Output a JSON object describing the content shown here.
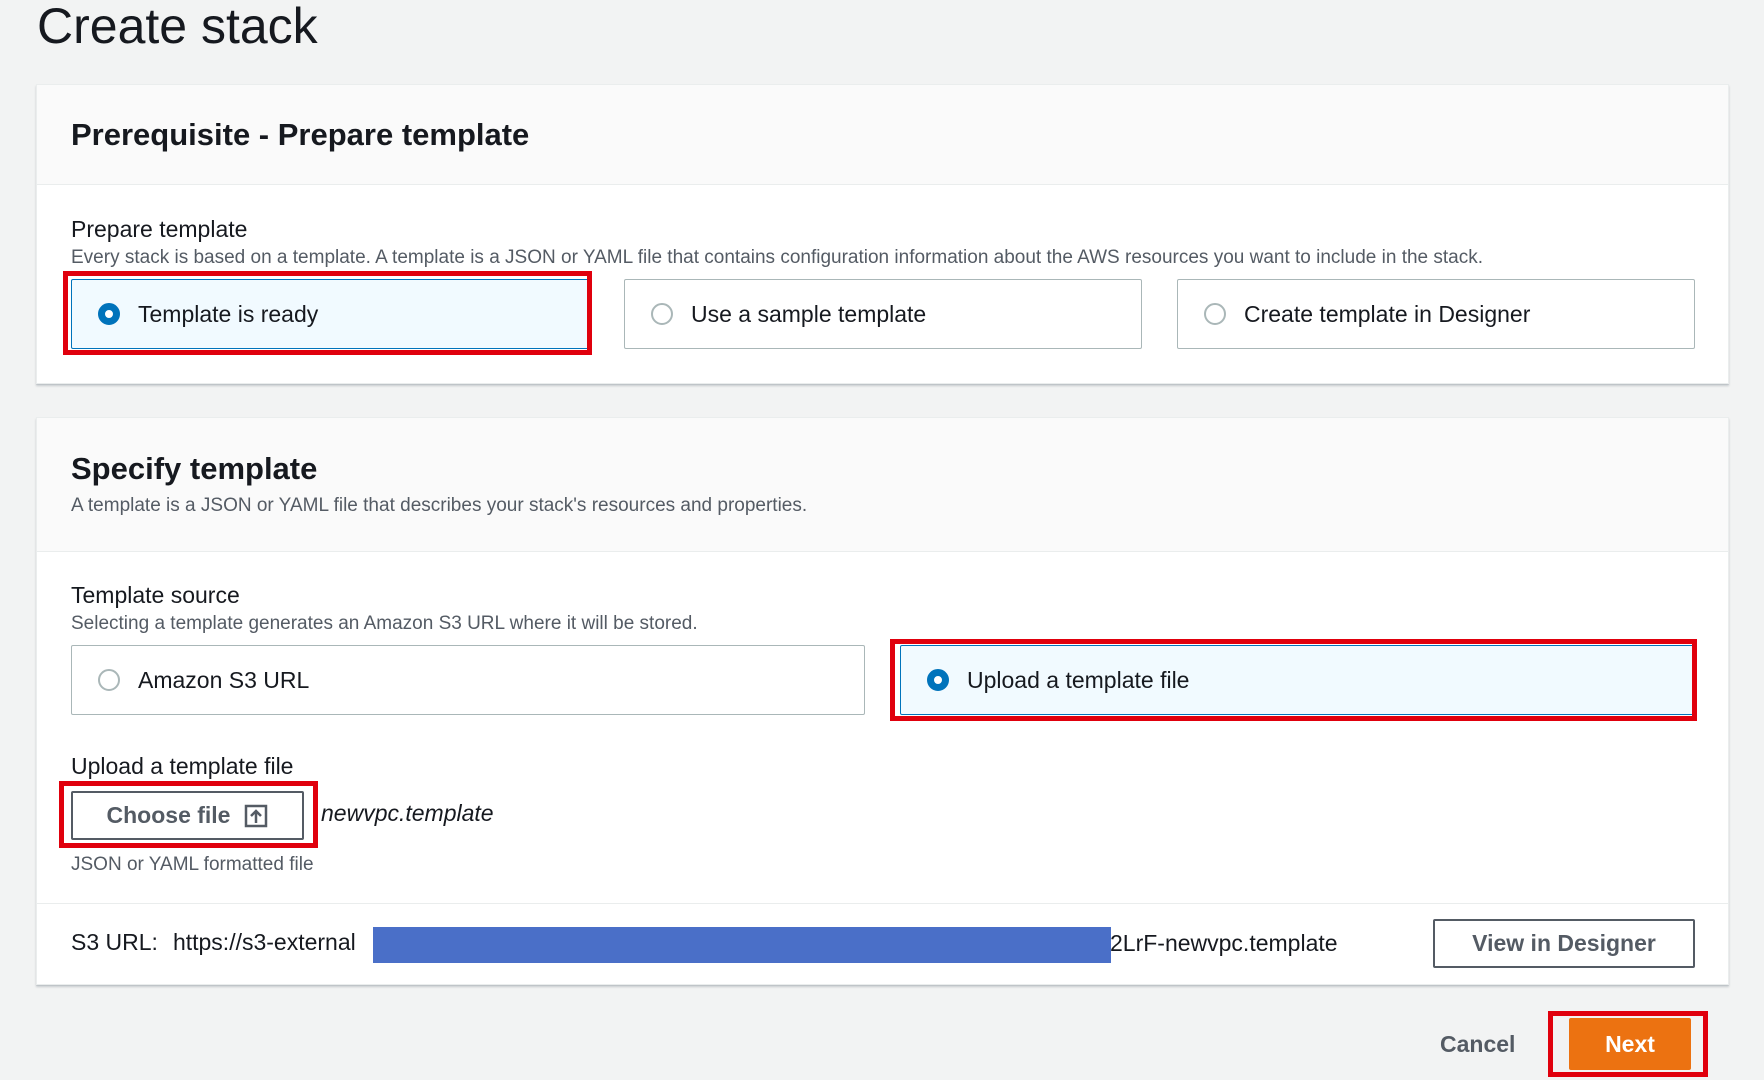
{
  "page": {
    "title": "Create stack"
  },
  "prerequisite": {
    "title": "Prerequisite - Prepare template",
    "field_label": "Prepare template",
    "field_desc": "Every stack is based on a template. A template is a JSON or YAML file that contains configuration information about the AWS resources you want to include in the stack.",
    "options": [
      {
        "label": "Template is ready",
        "selected": true
      },
      {
        "label": "Use a sample template",
        "selected": false
      },
      {
        "label": "Create template in Designer",
        "selected": false
      }
    ]
  },
  "specify": {
    "title": "Specify template",
    "desc": "A template is a JSON or YAML file that describes your stack's resources and properties.",
    "source_label": "Template source",
    "source_desc": "Selecting a template generates an Amazon S3 URL where it will be stored.",
    "source_options": [
      {
        "label": "Amazon S3 URL",
        "selected": false
      },
      {
        "label": "Upload a template file",
        "selected": true
      }
    ],
    "upload_label": "Upload a template file",
    "choose_file_label": "Choose file",
    "file_name": "newvpc.template",
    "upload_hint": "JSON or YAML formatted file",
    "s3_url_label": "S3 URL:",
    "s3_url_prefix": "https://s3-external",
    "s3_url_suffix": "2LrF-newvpc.template",
    "view_designer_label": "View in Designer"
  },
  "footer": {
    "cancel_label": "Cancel",
    "next_label": "Next"
  },
  "colors": {
    "accent": "#0073bb",
    "primary": "#ec7211",
    "highlight": "#e0000d",
    "redaction": "#4a6fc8"
  }
}
